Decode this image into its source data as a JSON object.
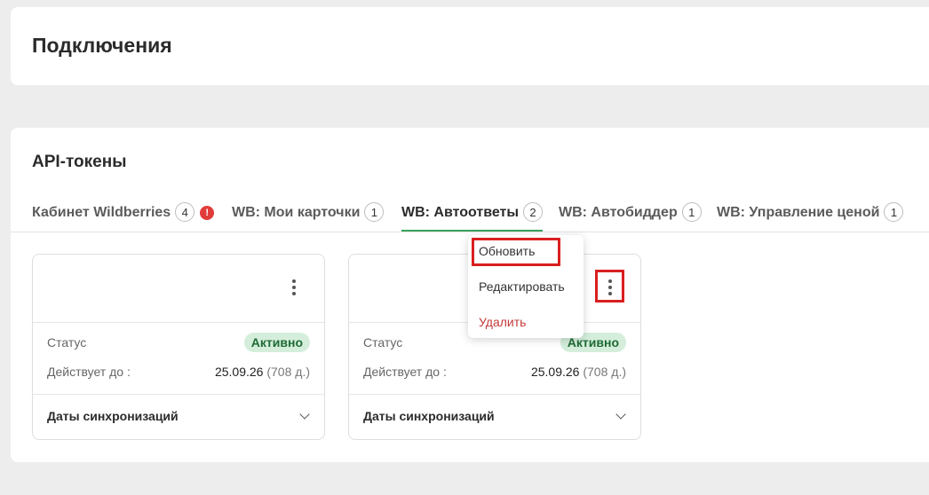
{
  "page": {
    "title": "Подключения"
  },
  "section": {
    "title": "API-токены"
  },
  "tabs": [
    {
      "label": "Кабинет Wildberries",
      "count": "4",
      "alert": "!"
    },
    {
      "label": "WB: Мои карточки",
      "count": "1"
    },
    {
      "label": "WB: Автоответы",
      "count": "2"
    },
    {
      "label": "WB: Автобиддер",
      "count": "1"
    },
    {
      "label": "WB: Управление ценой",
      "count": "1"
    }
  ],
  "active_tab_index": 2,
  "cards": [
    {
      "status_label": "Статус",
      "status_value": "Активно",
      "valid_label": "Действует до :",
      "valid_date": "25.09.26",
      "valid_days": "(708 д.)",
      "sync_label": "Даты синхронизаций"
    },
    {
      "status_label": "Статус",
      "status_value": "Активно",
      "valid_label": "Действует до :",
      "valid_date": "25.09.26",
      "valid_days": "(708 д.)",
      "sync_label": "Даты синхронизаций"
    }
  ],
  "context_menu": {
    "items": [
      "Обновить",
      "Редактировать",
      "Удалить"
    ]
  },
  "colors": {
    "active_tab_underline": "#3aa35b",
    "status_pill_bg": "#d4eedb",
    "danger": "#c33a3a",
    "highlight": "#d91f1f"
  }
}
